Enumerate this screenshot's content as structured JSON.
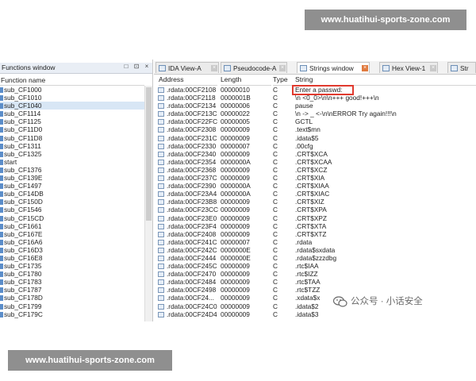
{
  "banners": {
    "top": "www.huatihui-sports-zone.com",
    "bottom": "www.huatihui-sports-zone.com"
  },
  "watermark": {
    "text": "公众号 · 小话安全"
  },
  "functions_window": {
    "title": "Functions window",
    "controls": [
      "□",
      "⊡",
      "×"
    ],
    "column_header": "Function name",
    "items": [
      "sub_CF1000",
      "sub_CF1010",
      "sub_CF1040",
      "sub_CF1114",
      "sub_CF1125",
      "sub_CF11D0",
      "sub_CF11D8",
      "sub_CF1311",
      "sub_CF1325",
      "start",
      "sub_CF1376",
      "sub_CF139E",
      "sub_CF1497",
      "sub_CF14DB",
      "sub_CF150D",
      "sub_CF1546",
      "sub_CF15CD",
      "sub_CF1661",
      "sub_CF167E",
      "sub_CF16A6",
      "sub_CF16D3",
      "sub_CF16E8",
      "sub_CF1735",
      "sub_CF1780",
      "sub_CF1783",
      "sub_CF1787",
      "sub_CF178D",
      "sub_CF1799",
      "sub_CF179C"
    ]
  },
  "tabs": [
    {
      "label": "IDA View-A",
      "close": "×"
    },
    {
      "label": "Pseudocode-A",
      "close": "×"
    },
    {
      "label": "Strings window",
      "close": "×"
    },
    {
      "label": "Hex View-1",
      "close": "×"
    },
    {
      "label": "Str",
      "close": ""
    }
  ],
  "strings_table": {
    "columns": {
      "address": "Address",
      "length": "Length",
      "type": "Type",
      "string": "String"
    },
    "rows": [
      {
        "address": ".rdata:00CF2108",
        "length": "00000010",
        "type": "C",
        "string": "Enter a passwd:"
      },
      {
        "address": ".rdata:00CF2118",
        "length": "0000001B",
        "type": "C",
        "string": "\\n   <0_0>\\n\\n+++ good!+++\\n"
      },
      {
        "address": ".rdata:00CF2134",
        "length": "00000006",
        "type": "C",
        "string": "pause"
      },
      {
        "address": ".rdata:00CF213C",
        "length": "00000022",
        "type": "C",
        "string": "\\n    -> _ <-\\n\\nERROR Try again!!!\\n"
      },
      {
        "address": ".rdata:00CF22FC",
        "length": "00000005",
        "type": "C",
        "string": "GCTL"
      },
      {
        "address": ".rdata:00CF2308",
        "length": "00000009",
        "type": "C",
        "string": ".text$mn"
      },
      {
        "address": ".rdata:00CF231C",
        "length": "00000009",
        "type": "C",
        "string": ".idata$5"
      },
      {
        "address": ".rdata:00CF2330",
        "length": "00000007",
        "type": "C",
        "string": ".00cfg"
      },
      {
        "address": ".rdata:00CF2340",
        "length": "00000009",
        "type": "C",
        "string": ".CRT$XCA"
      },
      {
        "address": ".rdata:00CF2354",
        "length": "0000000A",
        "type": "C",
        "string": ".CRT$XCAA"
      },
      {
        "address": ".rdata:00CF2368",
        "length": "00000009",
        "type": "C",
        "string": ".CRT$XCZ"
      },
      {
        "address": ".rdata:00CF237C",
        "length": "00000009",
        "type": "C",
        "string": ".CRT$XIA"
      },
      {
        "address": ".rdata:00CF2390",
        "length": "0000000A",
        "type": "C",
        "string": ".CRT$XIAA"
      },
      {
        "address": ".rdata:00CF23A4",
        "length": "0000000A",
        "type": "C",
        "string": ".CRT$XIAC"
      },
      {
        "address": ".rdata:00CF23B8",
        "length": "00000009",
        "type": "C",
        "string": ".CRT$XIZ"
      },
      {
        "address": ".rdata:00CF23CC",
        "length": "00000009",
        "type": "C",
        "string": ".CRT$XPA"
      },
      {
        "address": ".rdata:00CF23E0",
        "length": "00000009",
        "type": "C",
        "string": ".CRT$XPZ"
      },
      {
        "address": ".rdata:00CF23F4",
        "length": "00000009",
        "type": "C",
        "string": ".CRT$XTA"
      },
      {
        "address": ".rdata:00CF2408",
        "length": "00000009",
        "type": "C",
        "string": ".CRT$XTZ"
      },
      {
        "address": ".rdata:00CF241C",
        "length": "00000007",
        "type": "C",
        "string": ".rdata"
      },
      {
        "address": ".rdata:00CF242C",
        "length": "0000000E",
        "type": "C",
        "string": ".rdata$sxdata"
      },
      {
        "address": ".rdata:00CF2444",
        "length": "0000000E",
        "type": "C",
        "string": ".rdata$zzzdbg"
      },
      {
        "address": ".rdata:00CF245C",
        "length": "00000009",
        "type": "C",
        "string": ".rtc$IAA"
      },
      {
        "address": ".rdata:00CF2470",
        "length": "00000009",
        "type": "C",
        "string": ".rtc$IZZ"
      },
      {
        "address": ".rdata:00CF2484",
        "length": "00000009",
        "type": "C",
        "string": ".rtc$TAA"
      },
      {
        "address": ".rdata:00CF2498",
        "length": "00000009",
        "type": "C",
        "string": ".rtc$TZZ"
      },
      {
        "address": ".rdata:00CF24...",
        "length": "00000009",
        "type": "C",
        "string": ".xdata$x"
      },
      {
        "address": ".rdata:00CF24C0",
        "length": "00000009",
        "type": "C",
        "string": ".idata$2"
      },
      {
        "address": ".rdata:00CF24D4",
        "length": "00000009",
        "type": "C",
        "string": ".idata$3"
      }
    ]
  },
  "colors": {
    "highlight_box": "#e03a2e",
    "selection": "#d8e6f5",
    "banner_bg": "#8f8f8f"
  }
}
